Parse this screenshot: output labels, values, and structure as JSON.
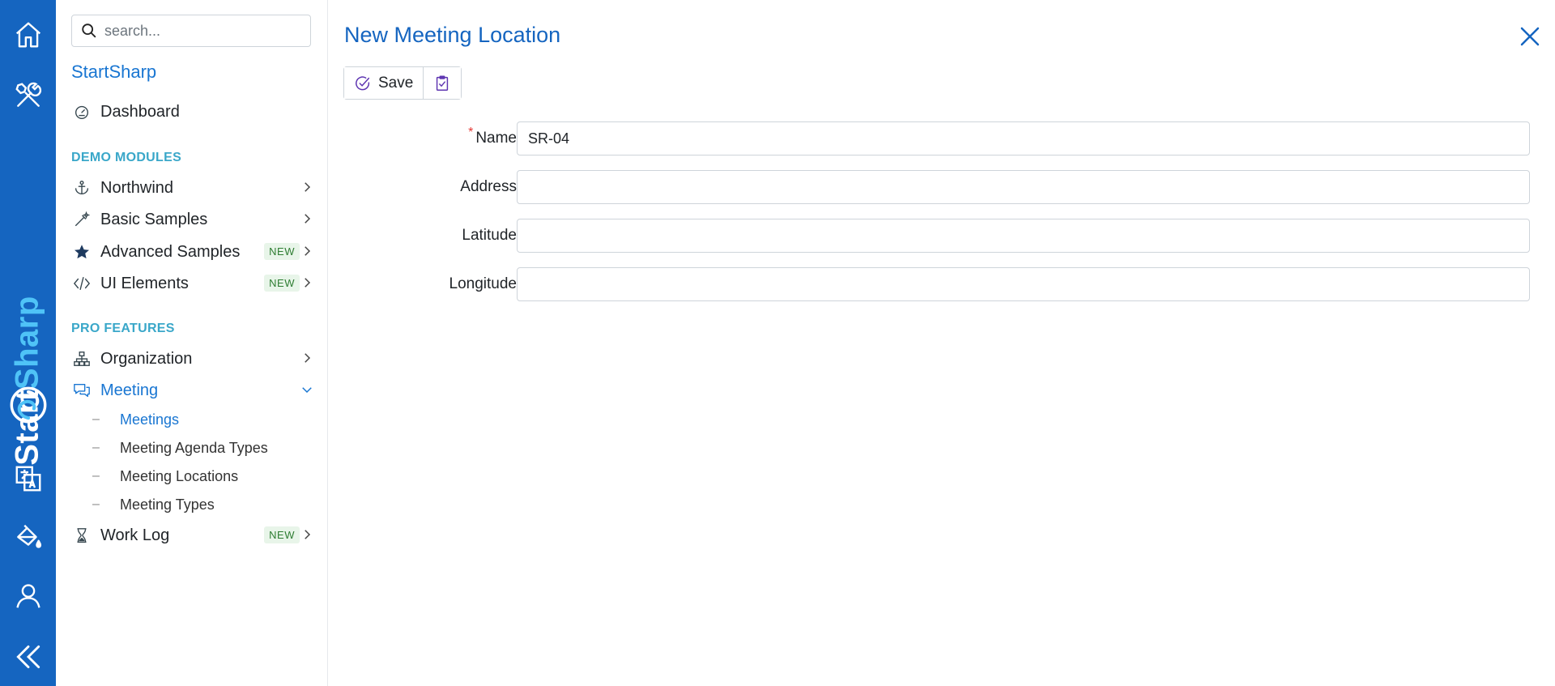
{
  "rail": {
    "brand_white": "Start",
    "brand_cyan": "Sharp",
    "icons": [
      "home-icon",
      "tools-icon",
      "translate-icon",
      "theme-icon",
      "user-icon",
      "collapse-icon"
    ]
  },
  "sidebar": {
    "search_placeholder": "search...",
    "brand": "StartSharp",
    "dashboard": "Dashboard",
    "demo_title": "DEMO MODULES",
    "northwind": "Northwind",
    "basic_samples": "Basic Samples",
    "advanced_samples": "Advanced Samples",
    "ui_elements": "UI Elements",
    "new_badge": "NEW",
    "pro_title": "PRO FEATURES",
    "organization": "Organization",
    "meeting": "Meeting",
    "meeting_sub": [
      "Meetings",
      "Meeting Agenda Types",
      "Meeting Locations",
      "Meeting Types"
    ],
    "work_log": "Work Log"
  },
  "main": {
    "title": "New Meeting Location",
    "save_label": "Save",
    "fields": {
      "name_label": "Name",
      "name_value": "SR-04",
      "address_label": "Address",
      "address_value": "",
      "latitude_label": "Latitude",
      "latitude_value": "",
      "longitude_label": "Longitude",
      "longitude_value": ""
    }
  },
  "colors": {
    "rail": "#1565c0",
    "accent": "#1976d2",
    "section": "#3aa7c9",
    "badge_text": "#2e7d32",
    "badge_bg": "#e8f5e9"
  }
}
